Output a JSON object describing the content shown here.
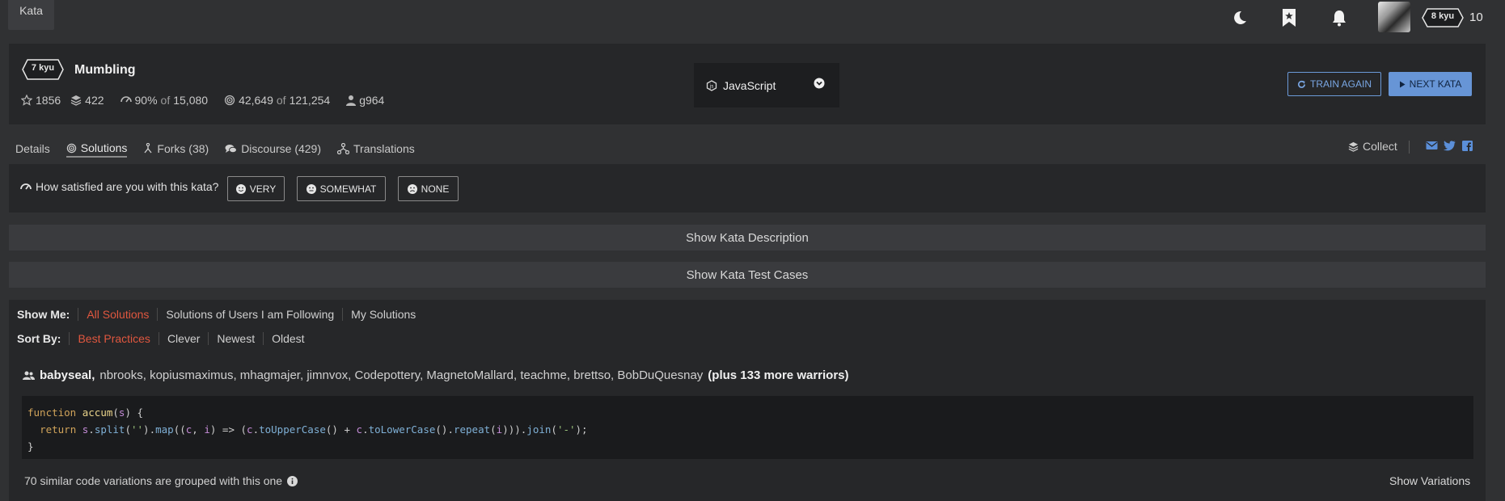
{
  "nav": {
    "kata_tab": "Kata",
    "rank": "8 kyu",
    "honor": "10"
  },
  "kata": {
    "rank": "7 kyu",
    "title": "Mumbling",
    "stars": "1856",
    "collections": "422",
    "satisfaction": "90%",
    "satisfaction_of": "of",
    "satisfaction_total": "15,080",
    "completed": "42,649",
    "completed_of": "of",
    "completed_total": "121,254",
    "author": "g964"
  },
  "language": {
    "selected": "JavaScript"
  },
  "actions": {
    "train_again": "TRAIN AGAIN",
    "next_kata": "NEXT KATA"
  },
  "tabs": [
    {
      "label": "Details"
    },
    {
      "label": "Solutions"
    },
    {
      "label": "Forks (38)"
    },
    {
      "label": "Discourse (429)"
    },
    {
      "label": "Translations"
    }
  ],
  "collect_label": "Collect",
  "satisfaction": {
    "question": "How satisfied are you with this kata?",
    "options": [
      "VERY",
      "SOMEWHAT",
      "NONE"
    ]
  },
  "show_description": "Show Kata Description",
  "show_test_cases": "Show Kata Test Cases",
  "filters": {
    "show_me_label": "Show Me:",
    "show_me": [
      "All Solutions",
      "Solutions of Users I am Following",
      "My Solutions"
    ],
    "sort_by_label": "Sort By:",
    "sort_by": [
      "Best Practices",
      "Clever",
      "Newest",
      "Oldest"
    ]
  },
  "solution": {
    "lead_user": "babyseal,",
    "other_users": "nbrooks, kopiusmaximus, mhagmajer, jimnvox, Codepottery, MagnetoMallard, teachme, brettso, BobDuQuesnay",
    "more": "(plus 133 more warriors)",
    "code_lines": [
      "function accum(s) {",
      "  return s.split('').map((c, i) => (c.toUpperCase() + c.toLowerCase().repeat(i))).join('-');",
      "}"
    ],
    "variations_text": "70 similar code variations are grouped with this one",
    "show_variations": "Show Variations"
  },
  "colors": {
    "accent_red": "#e0573f",
    "accent_blue": "#6795d6",
    "panel": "#262729",
    "background": "#303133"
  }
}
